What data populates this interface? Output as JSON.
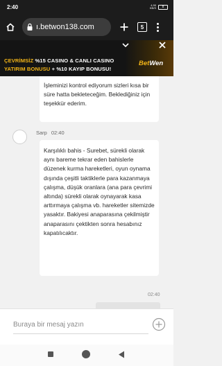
{
  "status_bar": {
    "time": "2:40",
    "network": "4,90\nKB/S",
    "battery": "8"
  },
  "browser": {
    "url": "ı.betwon138.com",
    "tab_count": "5"
  },
  "banner": {
    "line1_part1": "ÇEVRİMSİZ",
    "line1_part2": " %15 CASINO & CANLI CASINO",
    "line2_part1": "YATIRIM BONUSU",
    "line2_part2": " + %10 KAYIP BONUSU!",
    "logo_part1": "Bet",
    "logo_part2": "Wen",
    "accent_color": "#f2b418"
  },
  "chat": {
    "message1": "İşleminizi kontrol ediyorum sizleri kısa bir süre hatta bekleteceğim. Beklediğiniz için teşekkür ederim.",
    "sender_name": "Sarp",
    "sender_time": "02:40",
    "message2": "Karşılıklı bahis - Surebet, sürekli olarak aynı bareme tekrar eden bahislerle düzenek kurma hareketleri, oyun oynama dışında çeşitli taktiklerle para kazanmaya çalışma, düşük oranlara (ana para çevrimi altında) sürekli olarak oynayarak kasa arttırmaya çalışma vb. hareketler sitemizde yasaktır. Bakiyesi anaparasına çekilmiştir anaparasını çektikten sonra hesabınız kapatılıcaktır.",
    "last_time": "02:40"
  },
  "composer": {
    "placeholder": "Buraya bir mesaj yazın"
  }
}
